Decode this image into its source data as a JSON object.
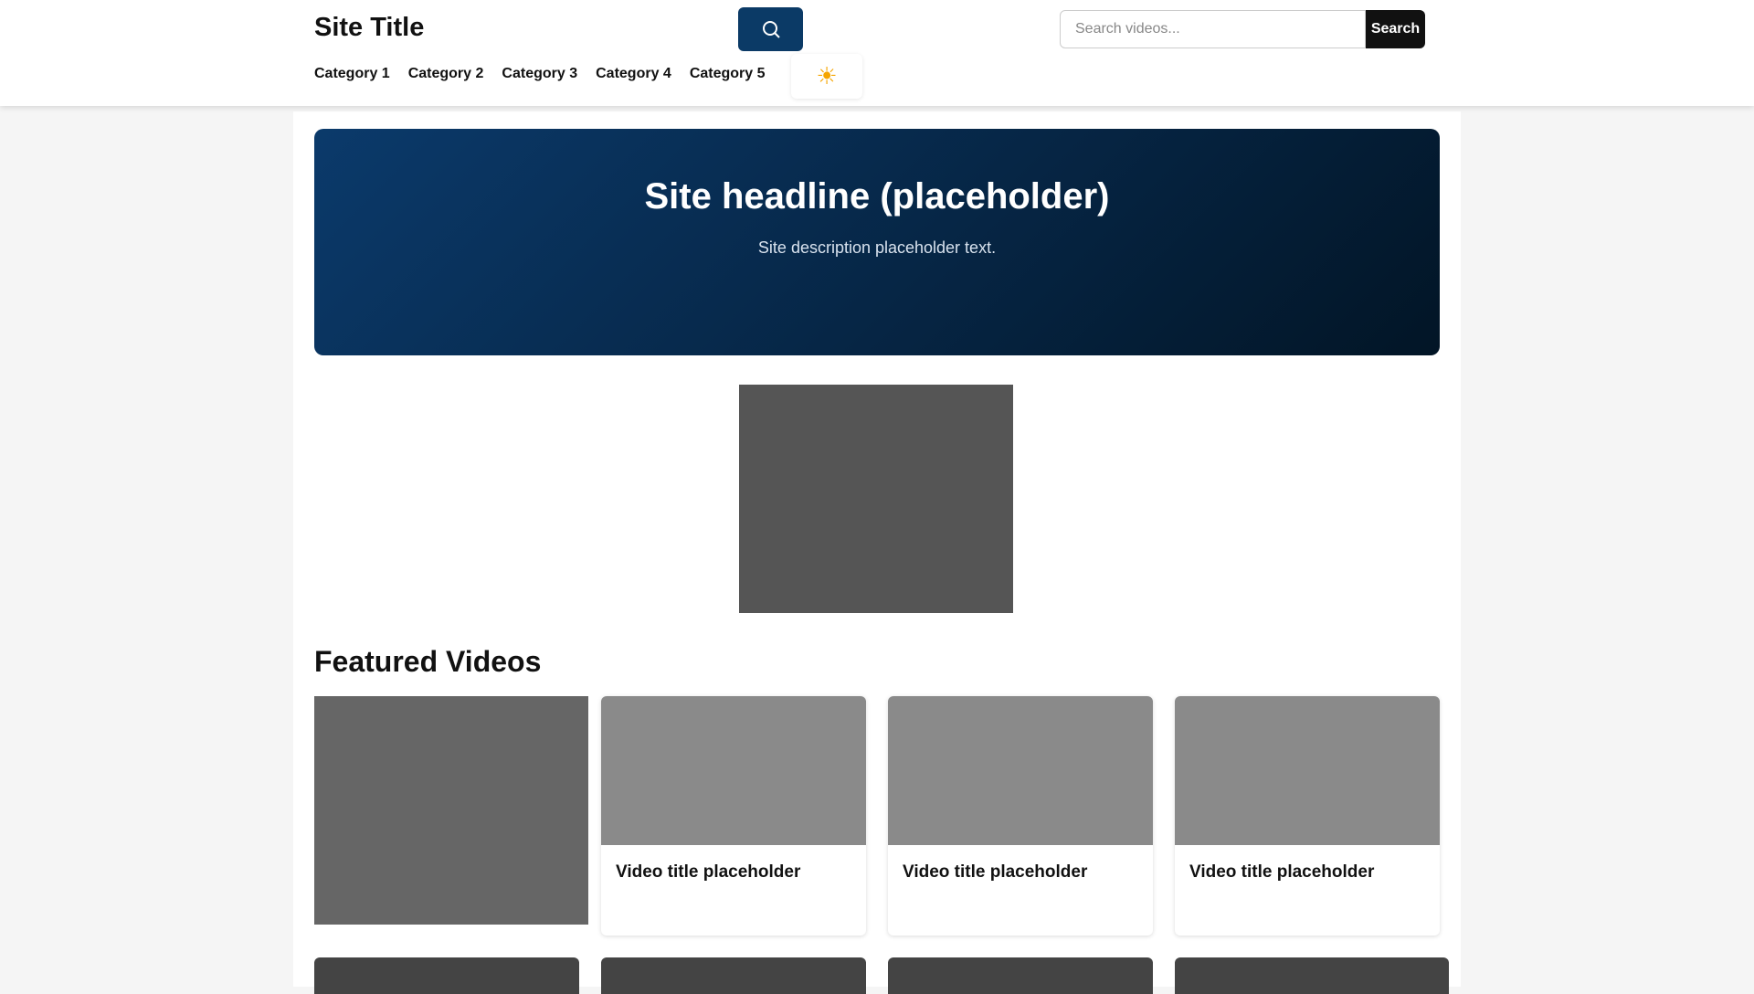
{
  "header": {
    "logo": "Site Title",
    "search_placeholder": "Search videos...",
    "search_button": "Search"
  },
  "nav": [
    "Category 1",
    "Category 2",
    "Category 3",
    "Category 4",
    "Category 5"
  ],
  "hero": {
    "title": "Site headline (placeholder)",
    "subtitle": "Site description placeholder text."
  },
  "section_title": "Featured Videos",
  "cards": [
    {
      "title": "Video title placeholder"
    },
    {
      "title": "Video title placeholder"
    },
    {
      "title": "Video title placeholder"
    }
  ]
}
